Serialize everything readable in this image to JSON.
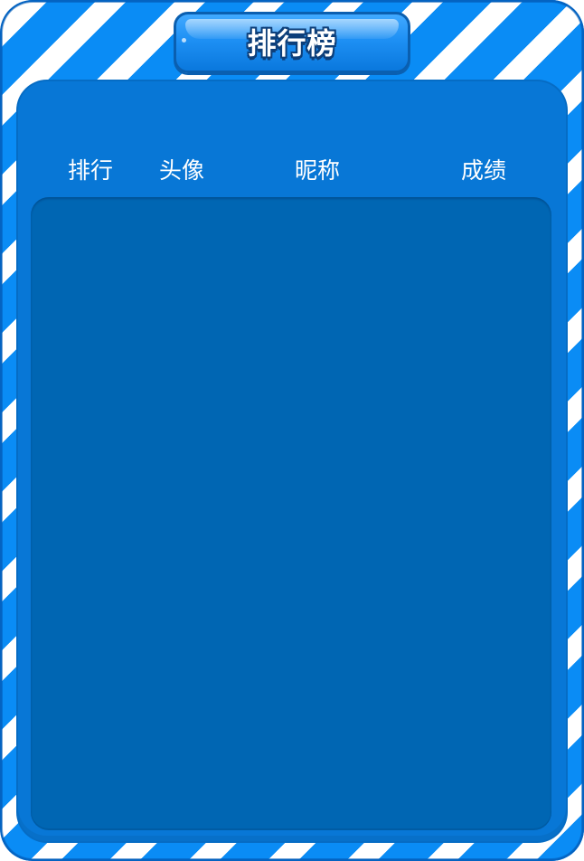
{
  "title": "排行榜",
  "columns": {
    "rank": "排行",
    "avatar": "头像",
    "nickname": "昵称",
    "score": "成绩"
  },
  "rows": [],
  "colors": {
    "stripe_blue": "#0a8cf5",
    "stripe_white": "#ffffff",
    "panel_blue": "#0877d6",
    "list_blue": "#0066b3",
    "title_outline": "#0d3f7a"
  }
}
